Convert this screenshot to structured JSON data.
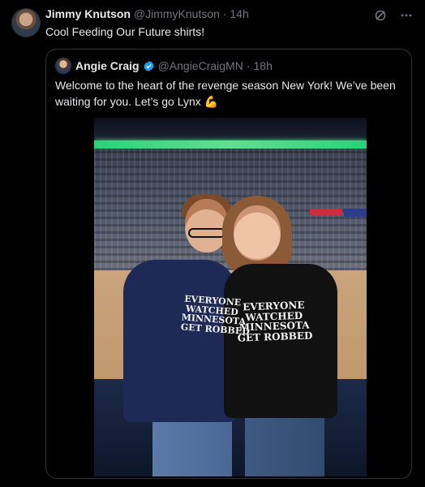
{
  "tweet": {
    "author_name": "Jimmy Knutson",
    "handle": "@JimmyKnutson",
    "separator": "·",
    "time": "14h",
    "text": "Cool Feeding Our Future shirts!"
  },
  "top_icons": [
    "grok-icon",
    "more-icon"
  ],
  "quote": {
    "author_name": "Angie Craig",
    "handle": "@AngieCraigMN",
    "separator": "·",
    "time": "18h",
    "text": "Welcome to the heart of the revenge season New York! We’ve been waiting for you. Let’s go Lynx",
    "emoji": "💪"
  },
  "photo": {
    "shirt_left": [
      "EVERYONE",
      "WATCHED",
      "MINNESOTA",
      "GET ROBBED"
    ],
    "shirt_right": [
      "EVERYONE",
      "WATCHED",
      "MINNESOTA",
      "GET ROBBED"
    ]
  },
  "colors": {
    "background": "#000000",
    "text_primary": "#e7e9ea",
    "text_secondary": "#71767b",
    "border": "#2f3336",
    "verified": "#1d9bf0"
  }
}
